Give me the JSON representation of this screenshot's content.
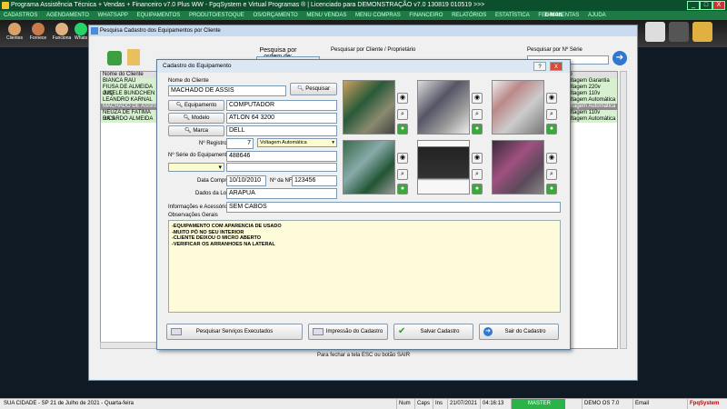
{
  "app": {
    "title": "Programa Assistência Técnica + Vendas + Financeiro v7.0 Plus WW - FpqSystem e Virtual Programas ® | Licenciado para  DEMONSTRAÇÃO v7.0 130819 010519 >>>",
    "win_min": "_",
    "win_max": "□",
    "win_close": "X"
  },
  "menu": [
    "CADASTROS",
    "AGENDAMENTO",
    "WHATSAPP",
    "EQUIPAMENTOS",
    "PRODUTO/ESTOQUE",
    "OS/ORÇAMENTO",
    "MENU VENDAS",
    "MENU COMPRAS",
    "FINANCEIRO",
    "RELATÓRIOS",
    "ESTATÍSTICA",
    "FERRAMENTAS",
    "AJUDA"
  ],
  "menu_email": "E-MAIL",
  "toolbar": [
    "Clientes",
    "Fornece",
    "Funciona",
    "WhatsApp"
  ],
  "bgwin": {
    "title": "Pesquisa Cadastro dos Equipamentos por Cliente",
    "search_order_label": "Pesquisa por ordem de:",
    "search_client_label": "Pesquisar por Cliente / Proprietário",
    "search_serial_label": "Pesquisar por Nº Série",
    "grid_header_left": "Nome do Cliente",
    "grid_header_right": "po",
    "clients": [
      "BIANCA RAU",
      "FIUSA DE ALMEIDA JUQ",
      "GISELE BUNDCHEN",
      "LEANDRO KARNAL",
      "MACHADO DE ASSIS",
      "NEUZA DE FATIMA DA S",
      "RICARDO ALMEIDA"
    ],
    "types": [
      "Voltagem Garantia",
      "Voltagem 220v",
      "Voltagem 110v",
      "Voltagem Automática",
      "Voltagem Automática",
      "Voltagem 110v",
      "Voltagem Automática"
    ]
  },
  "dlg": {
    "title": "Cadastro do Equipamento",
    "help": "?",
    "close": "X",
    "nome_cliente_label": "Nome do Cliente",
    "nome_cliente": "MACHADO DE ASSIS",
    "pesquisar": "Pesquisar",
    "equipamento_btn": "Equipamento",
    "equipamento": "COMPUTADOR",
    "modelo_btn": "Modelo",
    "modelo": "ATLON 64 3200",
    "marca_btn": "Marca",
    "marca": "DELL",
    "registro_label": "Nº Registro:",
    "registro": "7",
    "voltagem": "Voltagem Automática",
    "serie_label": "Nº Série do Equipamento:",
    "serie": "488646",
    "data_compra_label": "Data Compra:",
    "data_compra": "10/10/2010",
    "nf_label": "Nº da NF:",
    "nf": "123456",
    "loja_label": "Dados da Loja:",
    "loja": "ARAPUA",
    "acessorios_label": "Informações e Acessórios:",
    "acessorios": "SEM CABOS",
    "obs_label": "Observações Gerais",
    "obs_lines": [
      "-EQUIPAMENTO COM APARENCIA DE USADO",
      "-MUITO PÓ NO SEU INTERIOR",
      "-CLIENTE DEIXOU O MICRO ABERTO",
      "-VERIFICAR OS ARRANHOES NA LATERAL"
    ],
    "btn_servicos": "Pesquisar Serviços Executados",
    "btn_impressao": "Impressão do Cadastro",
    "btn_salvar": "Salvar Cadastro",
    "btn_sair": "Sair do Cadastro"
  },
  "hint": "Para fechar a tela ESC ou botão SAIR",
  "status": {
    "city": "SUA CIDADE - SP 21 de Julho de 2021 - Quarta-feira",
    "num": "Num",
    "caps": "Caps",
    "ins": "Ins",
    "date": "21/07/2021",
    "time": "04:16:13",
    "master": "MASTER",
    "demo": "DEMO OS 7.0",
    "email": "Email",
    "brand": "FpqSystem"
  }
}
